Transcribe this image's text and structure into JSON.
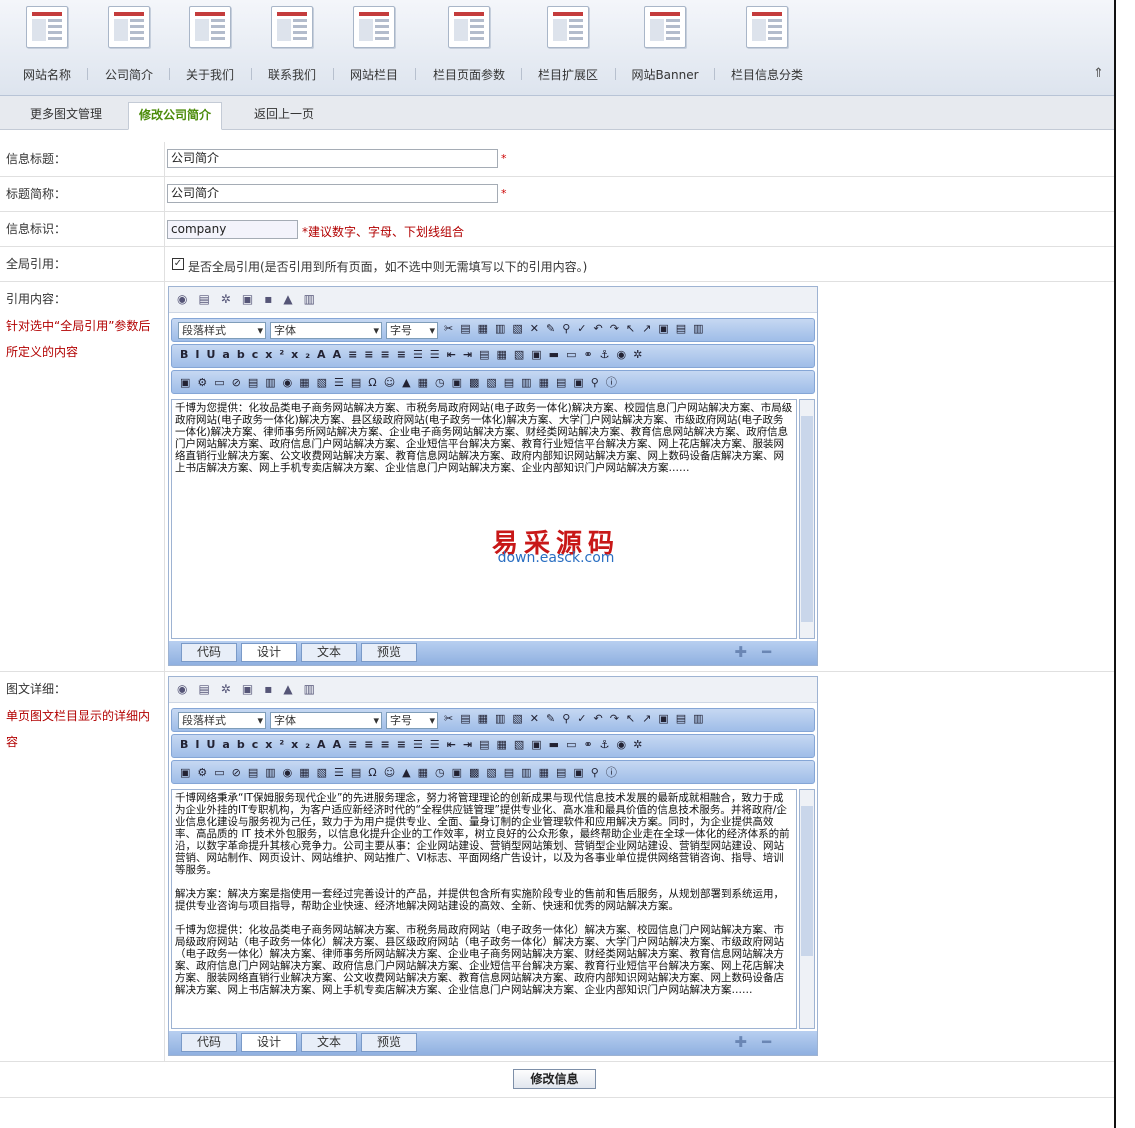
{
  "nav": {
    "items": [
      {
        "label": "网站名称"
      },
      {
        "label": "公司简介"
      },
      {
        "label": "关于我们"
      },
      {
        "label": "联系我们"
      },
      {
        "label": "网站栏目"
      },
      {
        "label": "栏目页面参数"
      },
      {
        "label": "栏目扩展区"
      },
      {
        "label": "网站Banner"
      },
      {
        "label": "栏目信息分类"
      }
    ],
    "back_top_icon": "up-arrow-icon"
  },
  "tabs": {
    "more": "更多图文管理",
    "edit": "修改公司简介",
    "back": "返回上一页"
  },
  "form": {
    "title_label": "信息标题：",
    "title_value": "公司简介",
    "required": "*",
    "short_label": "标题简称：",
    "short_value": "公司简介",
    "key_label": "信息标识：",
    "key_value": "company",
    "key_hint": "*建议数字、字母、下划线组合",
    "global_label": "全局引用：",
    "global_checked": true,
    "global_text": "是否全局引用(是否引用到所有页面，如不选中则无需填写以下的引用内容。)",
    "ref_label": "引用内容：",
    "ref_hint": "针对选中“全局引用”参数后所定义的内容",
    "detail_label": "图文详细：",
    "detail_hint": "单页图文栏目显示的详细内容"
  },
  "editor": {
    "paragraph": "段落样式",
    "font": "字体",
    "size": "字号",
    "modes": {
      "code": "代码",
      "design": "设计",
      "text": "文本",
      "preview": "预览"
    }
  },
  "ref_editor": {
    "content": "千博为您提供：化妆品类电子商务网站解决方案、市税务局政府网站(电子政务一体化)解决方案、校园信息门户网站解决方案、市局级政府网站(电子政务一体化)解决方案、县区级政府网站(电子政务一体化)解决方案、大学门户网站解决方案、市级政府网站(电子政务一体化)解决方案、律师事务所网站解决方案、企业电子商务网站解决方案、财经类网站解决方案、教育信息网站解决方案、政府信息门户网站解决方案、政府信息门户网站解决方案、企业短信平台解决方案、教育行业短信平台解决方案、网上花店解决方案、服装网络直销行业解决方案、公文收费网站解决方案、教育信息网站解决方案、政府内部知识网站解决方案、网上数码设备店解决方案、网上书店解决方案、网上手机专卖店解决方案、企业信息门户网站解决方案、企业内部知识门户网站解决方案……"
  },
  "detail_editor": {
    "p1": "千博网络秉承“IT保姆服务现代企业”的先进服务理念，努力将管理理论的创新成果与现代信息技术发展的最新成就相融合，致力于成为企业外挂的IT专职机构，为客户适应新经济时代的“全程供应链管理”提供专业化、高水准和最具价值的信息技术服务。并将政府/企业信息化建设与服务视为己任，致力于为用户提供专业、全面、量身订制的企业管理软件和应用解决方案。同时，为企业提供高效率、高品质的 IT 技术外包服务，以信息化提升企业的工作效率，树立良好的公众形象，最终帮助企业走在全球一体化的经济体系的前沿，以数字革命提升其核心竞争力。公司主要从事：企业网站建设、营销型网站策划、营销型企业网站建设、营销型网站建设、网站营销、网站制作、网页设计、网站维护、网站推广、VI标志、平面网络广告设计，以及为各事业单位提供网络营销咨询、指导、培训等服务。",
    "p2": "解决方案：解决方案是指使用一套经过完善设计的产品，并提供包含所有实施阶段专业的售前和售后服务，从规划部署到系统运用，提供专业咨询与项目指导，帮助企业快速、经济地解决网站建设的高效、全新、快速和优秀的网站解决方案。",
    "p3": "千博为您提供：化妆品类电子商务网站解决方案、市税务局政府网站（电子政务一体化）解决方案、校园信息门户网站解决方案、市局级政府网站（电子政务一体化）解决方案、县区级政府网站（电子政务一体化）解决方案、大学门户网站解决方案、市级政府网站（电子政务一体化）解决方案、律师事务所网站解决方案、企业电子商务网站解决方案、财经类网站解决方案、教育信息网站解决方案、政府信息门户网站解决方案、政府信息门户网站解决方案、企业短信平台解决方案、教育行业短信平台解决方案、网上花店解决方案、服装网络直销行业解决方案、公文收费网站解决方案、教育信息网站解决方案、政府内部知识网站解决方案、网上数码设备店解决方案、网上书店解决方案、网上手机专卖店解决方案、企业信息门户网站解决方案、企业内部知识门户网站解决方案……"
  },
  "watermark": {
    "cn": "易采源码",
    "url": "down.easck.com"
  },
  "submit": "修改信息"
}
